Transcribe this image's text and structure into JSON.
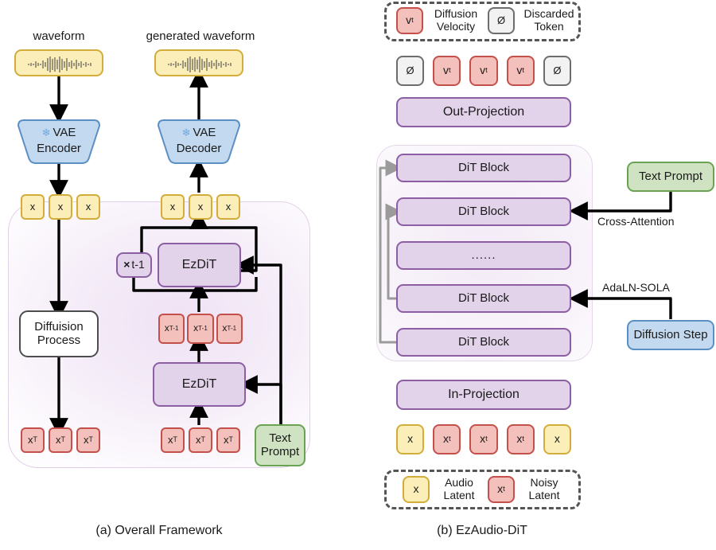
{
  "figure": {
    "caption_a": "(a) Overall Framework",
    "caption_b": "(b) EzAudio-DiT"
  },
  "panel_a": {
    "labels": {
      "waveform": "waveform",
      "generated_waveform": "generated waveform"
    },
    "nodes": {
      "vae_encoder_l1": "VAE",
      "vae_encoder_l2": "Encoder",
      "vae_decoder_l1": "VAE",
      "vae_decoder_l2": "Decoder",
      "diffusion_l1": "Diffuision",
      "diffusion_l2": "Process",
      "ezdit_top": "EzDiT",
      "ezdit_bottom": "EzDiT",
      "loop_count": "t-1",
      "loop_symbol": "×",
      "text_prompt_l1": "Text",
      "text_prompt_l2": "Prompt",
      "snowflake": "❄"
    },
    "tokens": {
      "latent_in": [
        "x",
        "x",
        "x"
      ],
      "latent_out": [
        "x",
        "x",
        "x"
      ],
      "noisy_T_left": [
        "x_T",
        "x_T",
        "x_T"
      ],
      "noisy_T_right": [
        "x_T",
        "x_T",
        "x_T"
      ],
      "noisy_T1": [
        "x_T-1",
        "x_T-1",
        "x_T-1"
      ]
    },
    "token_glyphs": {
      "x": "x",
      "x_T_base": "x",
      "x_T_sub": "T",
      "x_T1_base": "x",
      "x_T1_sub": "T-1"
    }
  },
  "panel_b": {
    "legend_top": {
      "item1_token_base": "v",
      "item1_token_sub": "t",
      "item1_label_l1": "Diffusion",
      "item1_label_l2": "Velocity",
      "item2_token": "Ø",
      "item2_label_l1": "Discarded",
      "item2_label_l2": "Token"
    },
    "legend_bottom": {
      "item1_token": "x",
      "item1_label_l1": "Audio",
      "item1_label_l2": "Latent",
      "item2_token_base": "x",
      "item2_token_sub": "t",
      "item2_label_l1": "Noisy",
      "item2_label_l2": "Latent"
    },
    "out_tokens": [
      "Ø",
      "v_t",
      "v_t",
      "v_t",
      "Ø"
    ],
    "in_tokens": [
      "x",
      "x_t",
      "x_t",
      "x_t",
      "x"
    ],
    "blocks": {
      "out_projection": "Out-Projection",
      "in_projection": "In-Projection",
      "dit_1": "DiT Block",
      "dit_2": "DiT Block",
      "dit_ellipsis": "......",
      "dit_3": "DiT Block",
      "dit_4": "DiT Block"
    },
    "side": {
      "text_prompt": "Text Prompt",
      "cross_attention": "Cross-Attention",
      "adaln_sola": "AdaLN-SOLA",
      "diffusion_step": "Diffusion Step"
    }
  },
  "colors": {
    "yellow_fill": "#fbeeb9",
    "yellow_border": "#d3ad3a",
    "red_fill": "#f4c0bb",
    "red_border": "#c4504b",
    "purple_fill": "#e2d2ea",
    "purple_border": "#8c5fa5",
    "blue_fill": "#c3d9f0",
    "blue_border": "#5a8fc4",
    "green_fill": "#cfe3c2",
    "green_border": "#6aa353",
    "gray_fill": "#f2f2f2",
    "gray_border": "#6d6d6d",
    "arrow_black": "#000000",
    "arrow_gray": "#9b9b9b"
  }
}
